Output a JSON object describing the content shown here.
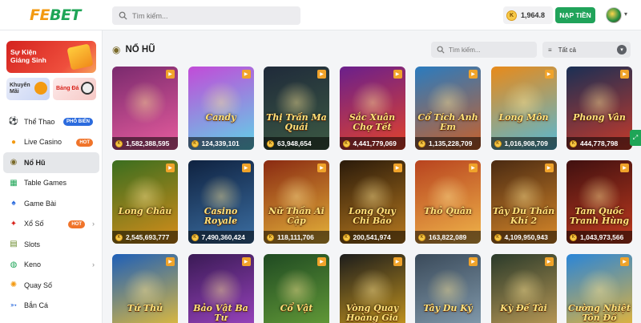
{
  "header": {
    "logo_fe": "FE",
    "logo_bet": "BET",
    "search_placeholder": "Tìm kiếm...",
    "balance": "1,964.8",
    "coin_letter": "K",
    "deposit_label": "NẠP TIỀN"
  },
  "sidebar": {
    "promo_main": "Sự Kiện\nGiáng Sinh",
    "promo_a": "Khuyến\nMãi",
    "promo_b": "Bảng Đá",
    "items": [
      {
        "label": "Thể Thao",
        "icon": "soccer-ball-icon",
        "glyph": "⚽",
        "badge": "PHỔ BIẾN"
      },
      {
        "label": "Live Casino",
        "icon": "casino-chip-icon",
        "glyph": "●",
        "badge": "HOT"
      },
      {
        "label": "Nổ Hũ",
        "icon": "jackpot-pot-icon",
        "glyph": "◉"
      },
      {
        "label": "Table Games",
        "icon": "table-games-icon",
        "glyph": "▦"
      },
      {
        "label": "Game Bài",
        "icon": "cards-icon",
        "glyph": "♠"
      },
      {
        "label": "Xổ Số",
        "icon": "lottery-icon",
        "glyph": "✦",
        "badge": "HOT"
      },
      {
        "label": "Slots",
        "icon": "slots-icon",
        "glyph": "▤"
      },
      {
        "label": "Keno",
        "icon": "keno-icon",
        "glyph": "◍"
      },
      {
        "label": "Quay Số",
        "icon": "spin-wheel-icon",
        "glyph": "✺"
      },
      {
        "label": "Bắn Cá",
        "icon": "fish-icon",
        "glyph": "➳"
      }
    ]
  },
  "main": {
    "title": "NỔ HŨ",
    "search_placeholder": "Tìm kiếm...",
    "filter_label": "Tất cả",
    "games": [
      {
        "name": "",
        "jackpot": "1,582,388,595",
        "colors": [
          "#7a2a6e",
          "#e85d9e"
        ]
      },
      {
        "name": "Candy",
        "jackpot": "124,339,101",
        "colors": [
          "#c24bd8",
          "#5fd3e8"
        ]
      },
      {
        "name": "Thị Trấn Ma Quái",
        "jackpot": "63,948,654",
        "colors": [
          "#1f2a3a",
          "#3c5a43"
        ]
      },
      {
        "name": "Sắc Xuân Chợ Tết",
        "jackpot": "4,441,779,069",
        "colors": [
          "#6a1f8c",
          "#e3432a"
        ]
      },
      {
        "name": "Cổ Tích Anh Em",
        "jackpot": "1,135,228,709",
        "colors": [
          "#2a7bbf",
          "#c9612a"
        ]
      },
      {
        "name": "Long Môn",
        "jackpot": "1,016,908,709",
        "colors": [
          "#e88a1a",
          "#56b9d6"
        ]
      },
      {
        "name": "Phong Vân",
        "jackpot": "444,778,798",
        "colors": [
          "#1a2f55",
          "#c73a2a"
        ]
      },
      {
        "name": "Long Châu",
        "jackpot": "2,545,693,777",
        "colors": [
          "#3a6e1f",
          "#d68d1a"
        ]
      },
      {
        "name": "Casino Royale",
        "jackpot": "7,490,360,424",
        "colors": [
          "#0f2240",
          "#3c6fa3"
        ]
      },
      {
        "name": "Nữ Thần Ai Cập",
        "jackpot": "118,111,706",
        "colors": [
          "#8a2a12",
          "#e5b33a"
        ]
      },
      {
        "name": "Long Quy Chi Bảo",
        "jackpot": "200,541,974",
        "colors": [
          "#2a1a0a",
          "#b87a1f"
        ]
      },
      {
        "name": "Thỏ Quân",
        "jackpot": "163,822,089",
        "colors": [
          "#b8431f",
          "#f0b54a"
        ]
      },
      {
        "name": "Tây Du Thần Khí 2",
        "jackpot": "4,109,950,943",
        "colors": [
          "#4a2a12",
          "#d9892a"
        ]
      },
      {
        "name": "Tam Quốc Tranh Hùng",
        "jackpot": "1,043,973,566",
        "colors": [
          "#401010",
          "#c23b1f"
        ]
      },
      {
        "name": "Tứ Thủ",
        "jackpot": "",
        "colors": [
          "#1e5fb8",
          "#f2c331"
        ]
      },
      {
        "name": "Bảo Vật Ba Tư",
        "jackpot": "",
        "colors": [
          "#3a1a55",
          "#a348c9"
        ]
      },
      {
        "name": "Cổ Vật",
        "jackpot": "",
        "colors": [
          "#1f4a22",
          "#6aa33a"
        ]
      },
      {
        "name": "Vòng Quay Hoàng Gia",
        "jackpot": "",
        "colors": [
          "#1c1c1c",
          "#d6a21f"
        ]
      },
      {
        "name": "Tây Du Ký",
        "jackpot": "",
        "colors": [
          "#3a4a5a",
          "#8aa3b5"
        ]
      },
      {
        "name": "Kỳ Đế Tài",
        "jackpot": "",
        "colors": [
          "#2a3a2a",
          "#c9a35a"
        ]
      },
      {
        "name": "Cường Nhiệt Tôn Đồ",
        "jackpot": "",
        "colors": [
          "#2a85d8",
          "#f5b82a"
        ]
      }
    ]
  }
}
